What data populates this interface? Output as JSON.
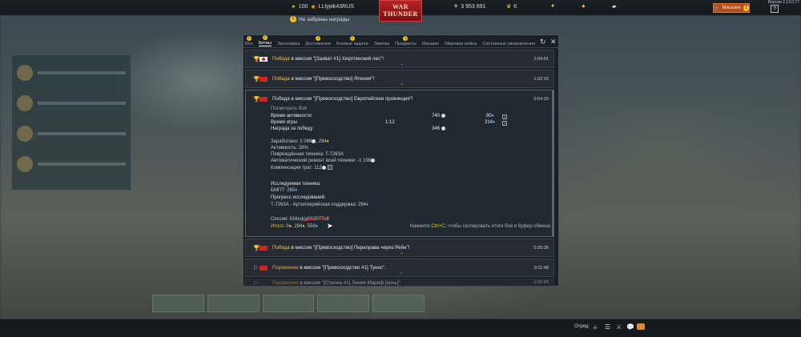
{
  "topbar": {
    "level": "100",
    "player_name": "LLlypik43RUS",
    "silver_lions": "3 953 891",
    "eagles_icon_value": "6",
    "logo_line1": "WAR",
    "logo_line2": "THUNDER",
    "shop_label": "Магазин",
    "shop_badge": "!",
    "help_label": "?",
    "version": "Версия 2.13.0.77"
  },
  "unclaimed_rewards": "Не забраны награды",
  "window": {
    "tabs": [
      {
        "label": "Все",
        "badge": "!"
      },
      {
        "label": "Битвы",
        "badge": "!"
      },
      {
        "label": "Экономика",
        "badge": ""
      },
      {
        "label": "Достижения",
        "badge": "!"
      },
      {
        "label": "Боевые задачи",
        "badge": "!"
      },
      {
        "label": "Экипаж",
        "badge": ""
      },
      {
        "label": "Предметы",
        "badge": "!"
      },
      {
        "label": "Магазин",
        "badge": ""
      },
      {
        "label": "Мировая война",
        "badge": ""
      },
      {
        "label": "Системные уведомления",
        "badge": ""
      }
    ],
    "refresh_icon": "↻",
    "close_icon": "✕"
  },
  "battles": [
    {
      "result": "Победа",
      "text": " в миссии \"[Захват #1] Хюртгенский лес\"!",
      "time": "1:04:01",
      "flag": "jp"
    },
    {
      "result": "Победа",
      "text": " в миссии \"[Превосходство] Япония\"!",
      "time": "1:02:15",
      "flag": "ussr"
    },
    {
      "result": "Победа",
      "text": " в миссии \"[Превосходство] Европейская провинция\"!",
      "time": "0:54:20",
      "flag": "ussr"
    },
    {
      "result": "Победа",
      "text": " в миссии \"[Превосходство] Переправа через Рейн\"!",
      "time": "0:25:36",
      "flag": "ussr"
    },
    {
      "result": "Поражение",
      "text": " в миссии \"[Превосходство #1] Тунис\".",
      "time": "0:11:48",
      "flag": "ussr"
    },
    {
      "result": "Поражение",
      "text": " в миссии \"[Стычка #1] Линия Мареф [ночь]\"",
      "time": "0:05:34",
      "flag": "ussr"
    }
  ],
  "details": {
    "watch_battle": "Посмотреть бой",
    "activity_time": "Время активности",
    "activity_time_sl": "740",
    "activity_time_rp": "80",
    "play_time": "Время игры",
    "play_time_value": "1:12",
    "play_time_rp": "214",
    "win_reward": "Награда за победу",
    "win_reward_sl": "346",
    "earned_label": "Заработано:",
    "earned_sl": "1 086",
    "earned_rp": "294",
    "activity_label": "Активность: 28%",
    "damaged_vehicles": "Повреждённая техника: T-7263A",
    "auto_repair_label": "Автоматический ремонт всей техники:",
    "auto_repair_value": "-1 198",
    "compensation_label": "Компенсация трат:",
    "compensation_value": "112",
    "researched_vehicles": "Исследуемая техника:",
    "bmpt": "БМПТ:",
    "bmpt_value": "265",
    "research_progress": "Прогресс исследований:",
    "research_item": "T-7263A - Артиллерийская поддержка:",
    "research_item_value": "294",
    "session": "Сессия: 616cdca002077c6",
    "total_label": "Итого:",
    "total_gold": "0",
    "total_rp": "294",
    "total_sl": "559",
    "hint_prefix": "Нажмите ",
    "hint_key": "Ctrl+C",
    "hint_suffix": ", чтобы скопировать итоги боя в буфер обмена"
  },
  "bottombar": {
    "squad_label": "Отряд:"
  }
}
